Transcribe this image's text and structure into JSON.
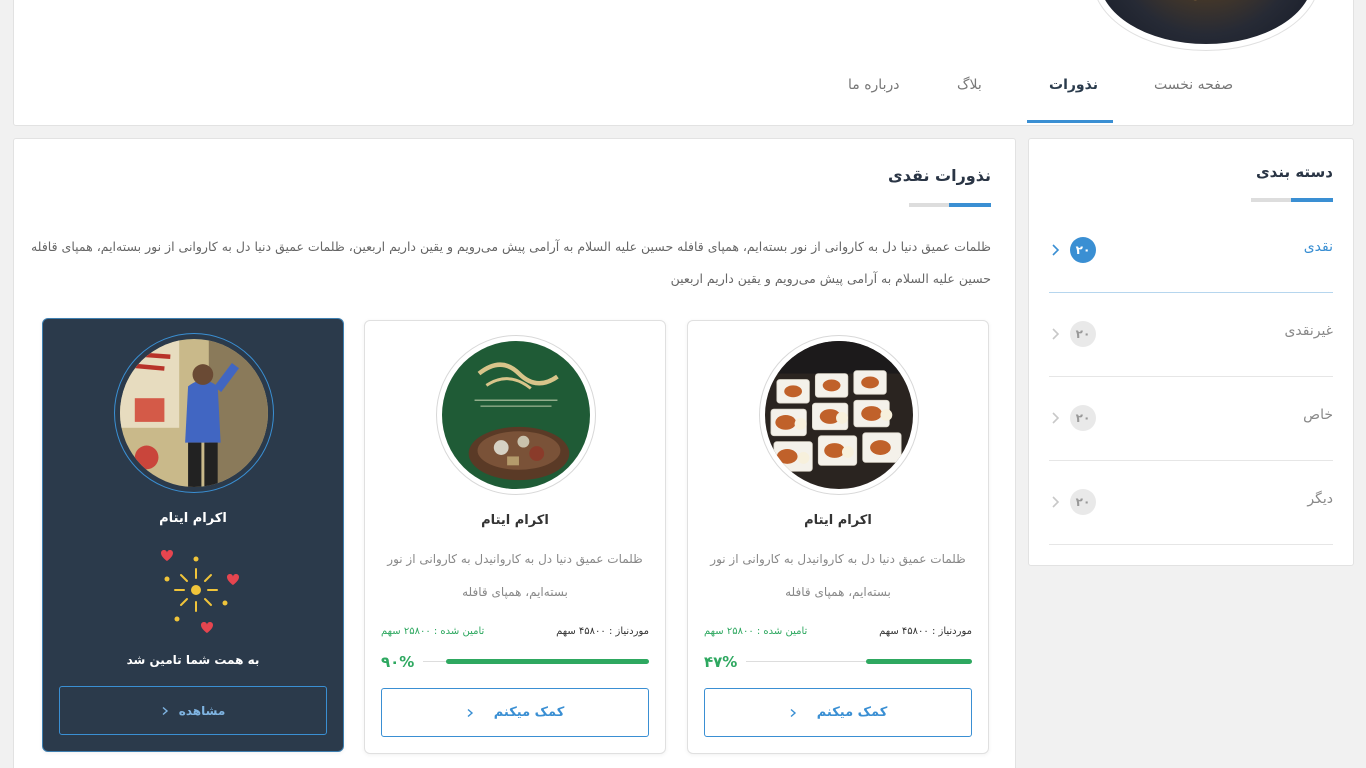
{
  "header": {
    "tabs": [
      {
        "label": "صفحه نخست",
        "active": false
      },
      {
        "label": "نذورات",
        "active": true
      },
      {
        "label": "بلاگ",
        "active": false
      },
      {
        "label": "درباره ما",
        "active": false
      }
    ]
  },
  "sidebar": {
    "title": "دسته بندی",
    "items": [
      {
        "label": "نقدی",
        "count": "۲۰",
        "active": true
      },
      {
        "label": "غیرنقدی",
        "count": "۲۰",
        "active": false
      },
      {
        "label": "خاص",
        "count": "۲۰",
        "active": false
      },
      {
        "label": "دیگر",
        "count": "۲۰",
        "active": false
      }
    ]
  },
  "main": {
    "title": "نذورات نقدی",
    "description": "ظلمات عمیق دنیا دل به کاروانی از نور بسته‌ایم، همپای قافله حسین علیه السلام به آرامی پیش می‌رویم و یقین داریم اربعین، ظلمات عمیق دنیا دل به کاروانی از نور بسته‌ایم، همپای قافله حسین علیه السلام به آرامی پیش می‌رویم و یقین داریم اربعین"
  },
  "cards": [
    {
      "title": "اکرام ایتام",
      "description": "ظلمات عمیق دنیا دل به کاروانیدل به کاروانی از نور بسته‌ایم، همپای قافله",
      "required": "موردنیاز : ۴۵۸۰۰ سهم",
      "funded": "تامین شده : ۲۵۸۰۰ سهم",
      "percent_label": "۴۷%",
      "percent": 47,
      "button": "کمک میکنم",
      "image_icon": "food-trays-image"
    },
    {
      "title": "اکرام ایتام",
      "description": "ظلمات عمیق دنیا دل به کاروانیدل به کاروانی از نور بسته‌ایم، همپای قافله",
      "required": "موردنیاز : ۴۵۸۰۰ سهم",
      "funded": "تامین شده : ۲۵۸۰۰ سهم",
      "percent_label": "۹۰%",
      "percent": 90,
      "button": "کمک میکنم",
      "image_icon": "nazr-poster-image"
    },
    {
      "title": "اکرام ایتام",
      "success_message": "به همت شما تامین شد",
      "button": "مشاهده",
      "image_icon": "boy-at-door-image"
    }
  ],
  "colors": {
    "accent": "#3a8fd3",
    "success": "#2ea860",
    "dark_card": "#2b3a4b"
  }
}
